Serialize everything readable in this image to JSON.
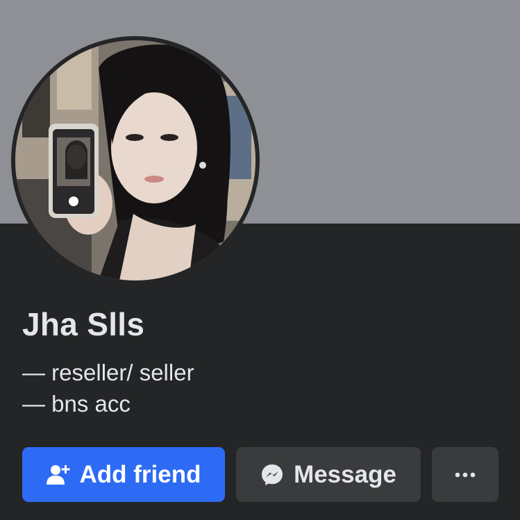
{
  "profile": {
    "name": "Jha Slls",
    "bio_lines": [
      "— reseller/ seller",
      "— bns acc"
    ]
  },
  "actions": {
    "add_friend_label": "Add friend",
    "message_label": "Message",
    "more_label": "···"
  },
  "icons": {
    "add_friend": "add-person-icon",
    "message": "messenger-icon",
    "more": "more-dots-icon"
  },
  "colors": {
    "cover": "#8e9096",
    "background": "#242526",
    "primary_button": "#2d6bf5",
    "secondary_button": "#3a3b3c",
    "text": "#e4e6eb"
  }
}
